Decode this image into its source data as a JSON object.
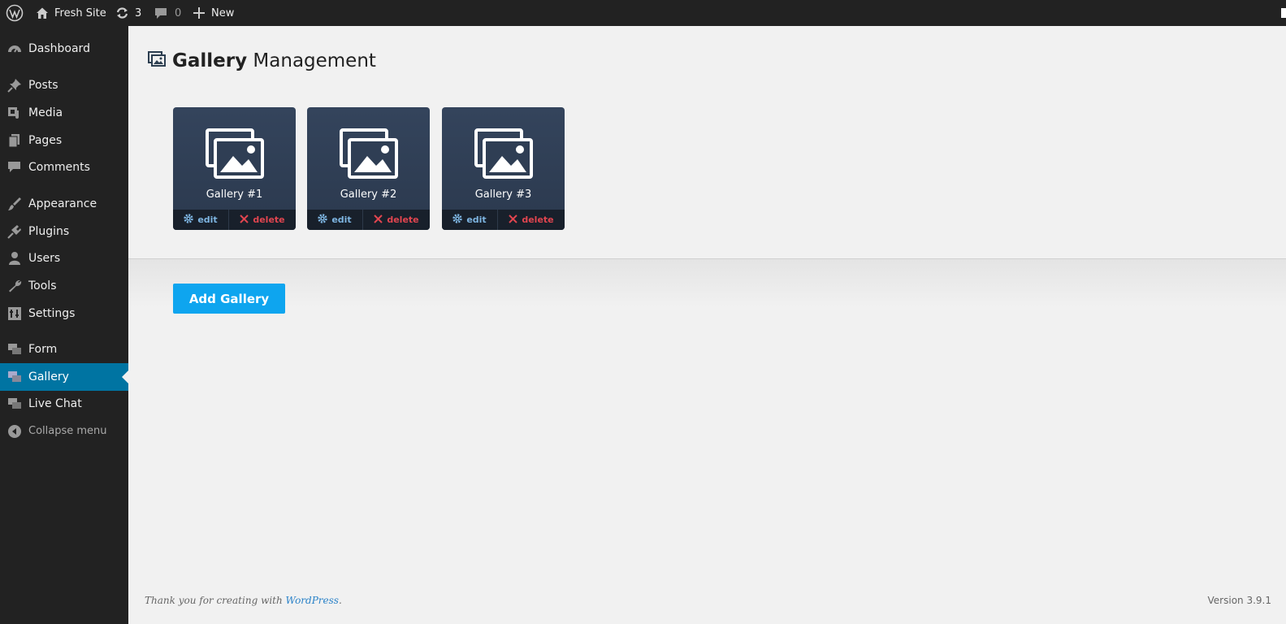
{
  "adminbar": {
    "site_name": "Fresh Site",
    "updates_count": "3",
    "comments_count": "0",
    "new_label": "New"
  },
  "sidebar": {
    "items": [
      {
        "label": "Dashboard",
        "icon": "dashboard-icon"
      },
      {
        "label": "Posts",
        "icon": "pin-icon"
      },
      {
        "label": "Media",
        "icon": "media-icon"
      },
      {
        "label": "Pages",
        "icon": "pages-icon"
      },
      {
        "label": "Comments",
        "icon": "comment-icon"
      },
      {
        "label": "Appearance",
        "icon": "brush-icon"
      },
      {
        "label": "Plugins",
        "icon": "plug-icon"
      },
      {
        "label": "Users",
        "icon": "user-icon"
      },
      {
        "label": "Tools",
        "icon": "wrench-icon"
      },
      {
        "label": "Settings",
        "icon": "settings-icon"
      },
      {
        "label": "Form",
        "icon": "chat-icon"
      },
      {
        "label": "Gallery",
        "icon": "chat-icon",
        "active": true
      },
      {
        "label": "Live Chat",
        "icon": "chat-icon"
      }
    ],
    "collapse_label": "Collapse menu"
  },
  "page": {
    "title_strong": "Gallery",
    "title_rest": "Management"
  },
  "galleries": [
    {
      "title": "Gallery #1",
      "edit_label": "edit",
      "delete_label": "delete"
    },
    {
      "title": "Gallery #2",
      "edit_label": "edit",
      "delete_label": "delete"
    },
    {
      "title": "Gallery #3",
      "edit_label": "edit",
      "delete_label": "delete"
    }
  ],
  "add_button_label": "Add Gallery",
  "footer": {
    "thanks_prefix": "Thank you for creating with ",
    "wordpress_link": "WordPress",
    "thanks_suffix": ".",
    "version": "Version 3.9.1"
  },
  "colors": {
    "accent": "#0074a2",
    "button": "#0ea5ef",
    "card": "#2f3e54",
    "delete": "#e0454f",
    "edit": "#7db4e0"
  }
}
